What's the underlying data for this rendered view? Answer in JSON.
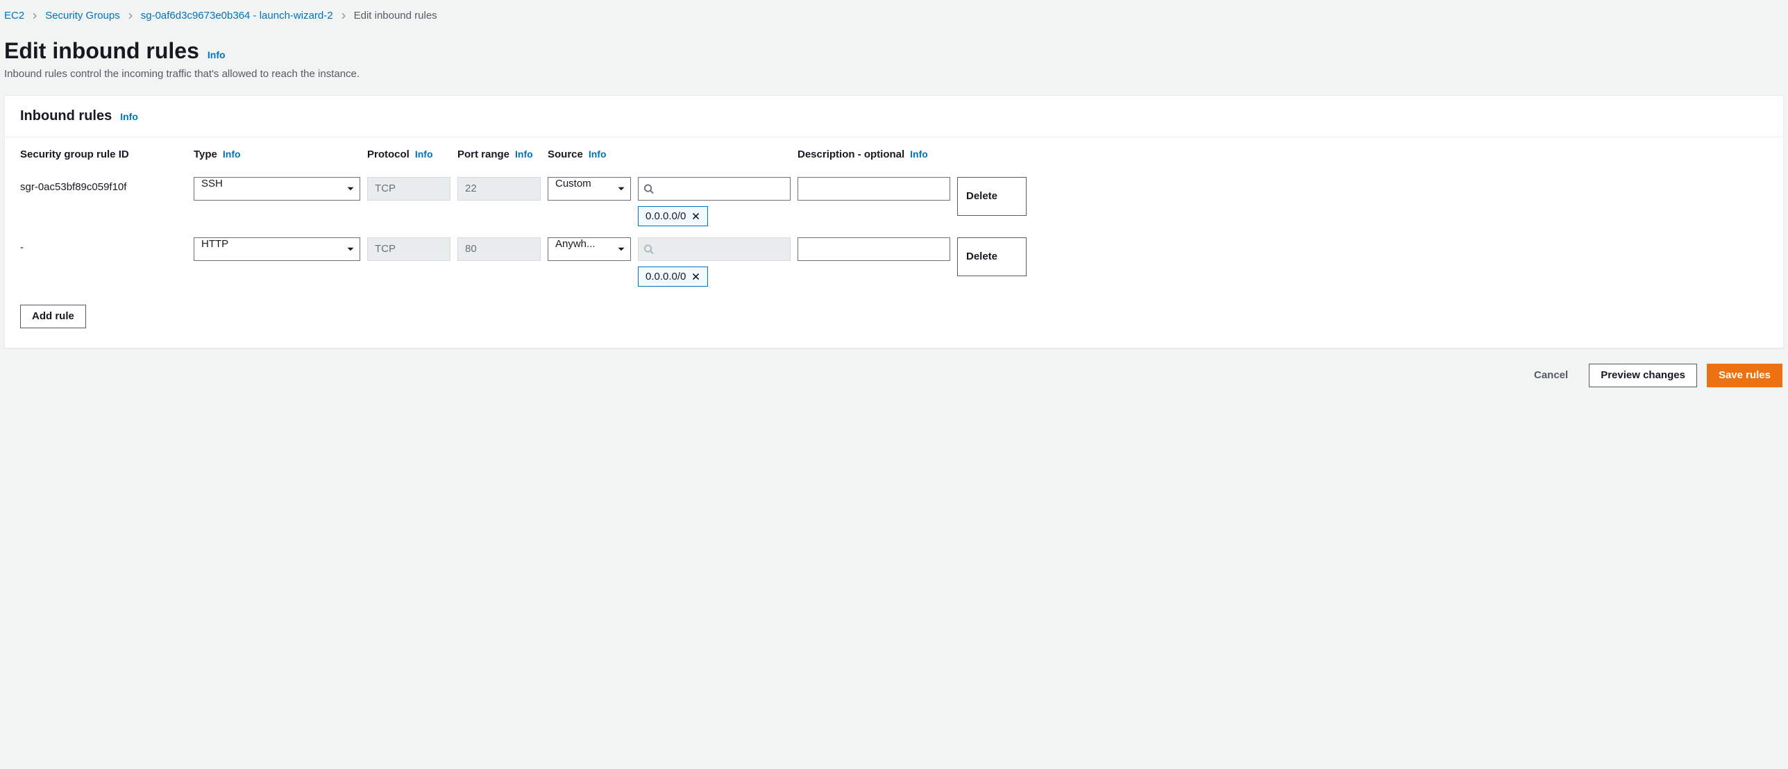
{
  "breadcrumb": {
    "items": [
      {
        "label": "EC2"
      },
      {
        "label": "Security Groups"
      },
      {
        "label": "sg-0af6d3c9673e0b364 - launch-wizard-2"
      }
    ],
    "current": "Edit inbound rules"
  },
  "page": {
    "title": "Edit inbound rules",
    "title_info": "Info",
    "subtitle": "Inbound rules control the incoming traffic that's allowed to reach the instance."
  },
  "panel": {
    "title": "Inbound rules",
    "title_info": "Info"
  },
  "columns": {
    "rule_id": "Security group rule ID",
    "type": "Type",
    "type_info": "Info",
    "protocol": "Protocol",
    "protocol_info": "Info",
    "port_range": "Port range",
    "port_range_info": "Info",
    "source": "Source",
    "source_info": "Info",
    "description": "Description - optional",
    "description_info": "Info"
  },
  "rules": [
    {
      "id": "sgr-0ac53bf89c059f10f",
      "type": "SSH",
      "protocol": "TCP",
      "port_range": "22",
      "source_mode": "Custom",
      "source_search_disabled": false,
      "source_tokens": [
        "0.0.0.0/0"
      ],
      "description": "",
      "delete_label": "Delete"
    },
    {
      "id": "-",
      "type": "HTTP",
      "protocol": "TCP",
      "port_range": "80",
      "source_mode": "Anywh...",
      "source_search_disabled": true,
      "source_tokens": [
        "0.0.0.0/0"
      ],
      "description": "",
      "delete_label": "Delete"
    }
  ],
  "buttons": {
    "add_rule": "Add rule",
    "cancel": "Cancel",
    "preview": "Preview changes",
    "save": "Save rules"
  }
}
